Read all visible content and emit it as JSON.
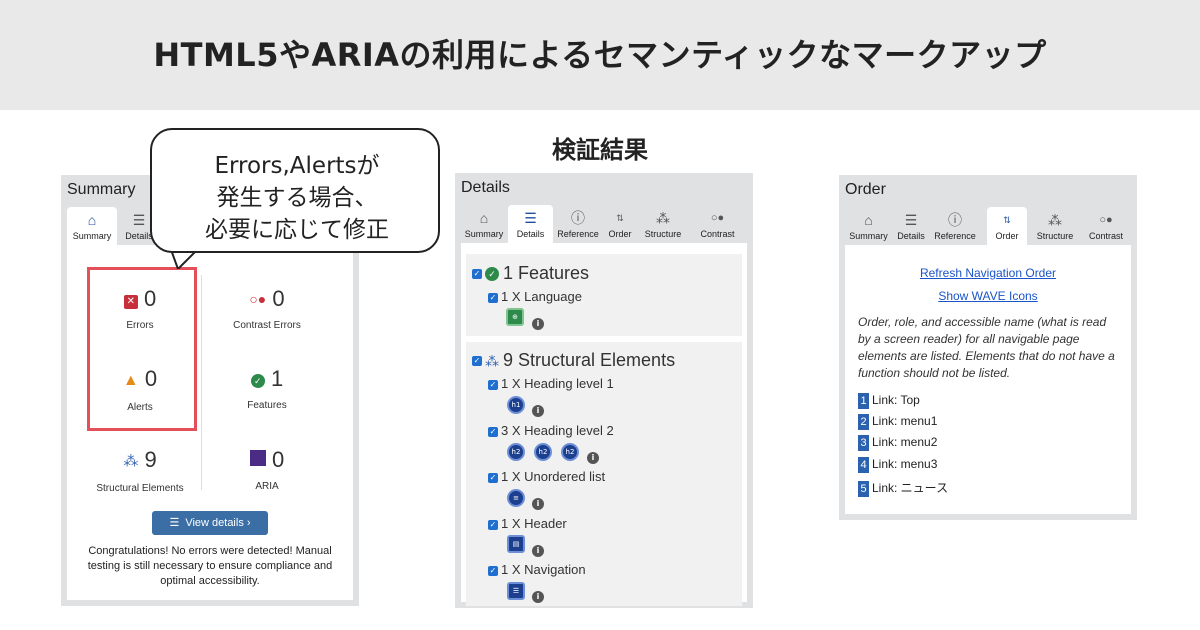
{
  "page": {
    "title": "HTML5やARIAの利用によるセマンティックなマークアップ",
    "subtitle": "検証結果"
  },
  "callout": {
    "lines": [
      "Errors,Alertsが",
      "発生する場合、",
      "必要に応じて修正"
    ]
  },
  "summary_panel": {
    "title": "Summary",
    "tabs": [
      {
        "label": "Summary",
        "icon": "home-icon"
      },
      {
        "label": "Details",
        "icon": "list-icon"
      }
    ],
    "cells": [
      {
        "icon": "error-icon",
        "count": "0",
        "label": "Errors"
      },
      {
        "icon": "contrast-icon",
        "count": "0",
        "label": "Contrast Errors"
      },
      {
        "icon": "alert-icon",
        "count": "0",
        "label": "Alerts"
      },
      {
        "icon": "check-icon",
        "count": "1",
        "label": "Features"
      },
      {
        "icon": "structure-icon",
        "count": "9",
        "label": "Structural Elements"
      },
      {
        "icon": "aria-icon",
        "count": "0",
        "label": "ARIA"
      }
    ],
    "view_details": "View details ›",
    "message": "Congratulations! No errors were detected! Manual testing is still necessary to ensure compliance and optimal accessibility."
  },
  "details_panel": {
    "title": "Details",
    "tabs": [
      {
        "label": "Summary",
        "icon": "home-icon"
      },
      {
        "label": "Details",
        "icon": "list-icon"
      },
      {
        "label": "Reference",
        "icon": "info-icon"
      },
      {
        "label": "Order",
        "icon": "order-icon"
      },
      {
        "label": "Structure",
        "icon": "structure-icon"
      },
      {
        "label": "Contrast",
        "icon": "contrast-icon"
      }
    ],
    "features_heading": "1 Features",
    "features_items": [
      "1 X Language"
    ],
    "structure_heading": "9 Structural Elements",
    "structure_items": [
      "1 X Heading level 1",
      "3 X Heading level 2",
      "1 X Unordered list",
      "1 X Header",
      "1 X Navigation"
    ],
    "icon_labels": {
      "h1": "h1",
      "h2": "h2"
    }
  },
  "order_panel": {
    "title": "Order",
    "tabs": [
      {
        "label": "Summary",
        "icon": "home-icon"
      },
      {
        "label": "Details",
        "icon": "list-icon"
      },
      {
        "label": "Reference",
        "icon": "info-icon"
      },
      {
        "label": "Order",
        "icon": "order-icon"
      },
      {
        "label": "Structure",
        "icon": "structure-icon"
      },
      {
        "label": "Contrast",
        "icon": "contrast-icon"
      }
    ],
    "refresh_link": "Refresh Navigation Order",
    "show_icons_link": "Show WAVE Icons",
    "description": "Order, role, and accessible name (what is read by a screen reader) for all navigable page elements are listed. Elements that do not have a function should not be listed.",
    "items": [
      {
        "num": "1",
        "text": "Link: Top"
      },
      {
        "num": "2",
        "text": "Link: menu1"
      },
      {
        "num": "3",
        "text": "Link: menu2"
      },
      {
        "num": "4",
        "text": "Link: menu3"
      },
      {
        "num": "5",
        "text": "Link: ニュース"
      }
    ]
  },
  "colors": {
    "error": "#e4505a",
    "link": "#1a55c9",
    "button": "#3a6ea5",
    "checkbox": "#1f6fd0"
  }
}
